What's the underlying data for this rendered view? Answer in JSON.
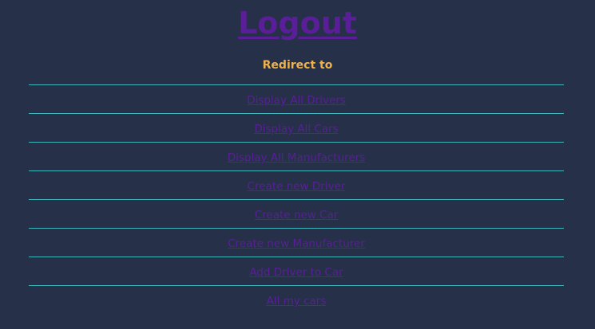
{
  "logout": {
    "label": "Logout"
  },
  "redirect_heading": "Redirect to",
  "links": [
    {
      "label": "Display All Drivers"
    },
    {
      "label": "Display All Cars"
    },
    {
      "label": "Display All Manufacturers"
    },
    {
      "label": "Create new Driver"
    },
    {
      "label": "Create new Car"
    },
    {
      "label": "Create new Manufacturer"
    },
    {
      "label": "Add Driver to Car"
    },
    {
      "label": "All my cars"
    }
  ],
  "colors": {
    "background": "#263048",
    "link": "#5a1e99",
    "heading": "#f0b24a",
    "divider": "#3bb7bd"
  }
}
